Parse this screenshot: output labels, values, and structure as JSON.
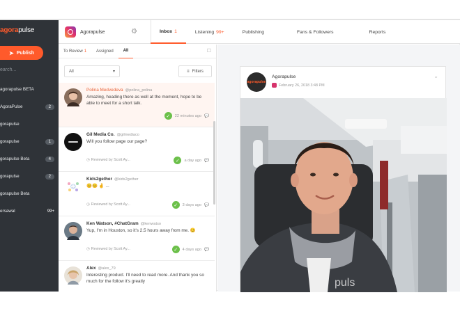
{
  "brand": {
    "logo_a": "agora",
    "logo_rest": "pulse"
  },
  "sidebar": {
    "publish_label": "Publish",
    "search_placeholder": "earch...",
    "items": [
      {
        "label": "agorapulse BETA",
        "badge": ""
      },
      {
        "label": "AgoraPulse",
        "badge": "2"
      },
      {
        "label": "gorapulse",
        "badge": ""
      },
      {
        "label": "gorapulse",
        "badge": "1"
      },
      {
        "label": "gorapulse Beta",
        "badge": "4"
      },
      {
        "label": "gorapulse",
        "badge": "2"
      },
      {
        "label": "gorapulse Beta",
        "badge": ""
      },
      {
        "label": "ersawal",
        "badge": "99+"
      }
    ]
  },
  "header": {
    "account_name": "Agorapulse",
    "tabs": [
      {
        "label": "Inbox",
        "count": "1"
      },
      {
        "label": "Listening",
        "count": "99+"
      },
      {
        "label": "Publishing",
        "count": ""
      },
      {
        "label": "Fans & Followers",
        "count": ""
      },
      {
        "label": "Reports",
        "count": ""
      }
    ]
  },
  "inbox": {
    "filter_tabs": [
      {
        "label": "To Review",
        "count": "1"
      },
      {
        "label": "Assigned",
        "count": ""
      },
      {
        "label": "All",
        "count": ""
      }
    ],
    "select_value": "All",
    "filters_label": "Filters",
    "messages": [
      {
        "name": "Polina Medvedeva",
        "handle": "@polina_polina",
        "text": "Amazing, heading there as well at the moment, hope to be able to meet for a short talk.",
        "reviewed": "",
        "time": "22 minutes ago"
      },
      {
        "name": "Gil Media Co.",
        "handle": "@gilmediaco",
        "text": "Will you follow page our page?",
        "reviewed": "Reviewed by Scott Ay...",
        "time": "a day ago"
      },
      {
        "name": "Kids2gether",
        "handle": "@kids2gether",
        "text": "😊😊 ✌ ...",
        "reviewed": "Reviewed by Scott Ay...",
        "time": "3 days ago"
      },
      {
        "name": "Ken Watson, #ChatGram",
        "handle": "@kenwatso",
        "text": "Yup, I'm in Houston, so it's 2.5 hours away from me. 😊",
        "reviewed": "Reviewed by Scott Ay...",
        "time": "4 days ago"
      },
      {
        "name": "Alex",
        "handle": "@alex_79",
        "text": "Interesting product. I'll need to read more. And thank you so much for the follow it's greatly",
        "reviewed": "",
        "time": ""
      }
    ]
  },
  "post": {
    "author": "Agorapulse",
    "date": "February 26, 2018 3:48 PM",
    "avatar_text": "agorapulse"
  },
  "colors": {
    "accent": "#ff5a2b",
    "sidebar": "#2f3338",
    "check": "#6cc04a"
  }
}
